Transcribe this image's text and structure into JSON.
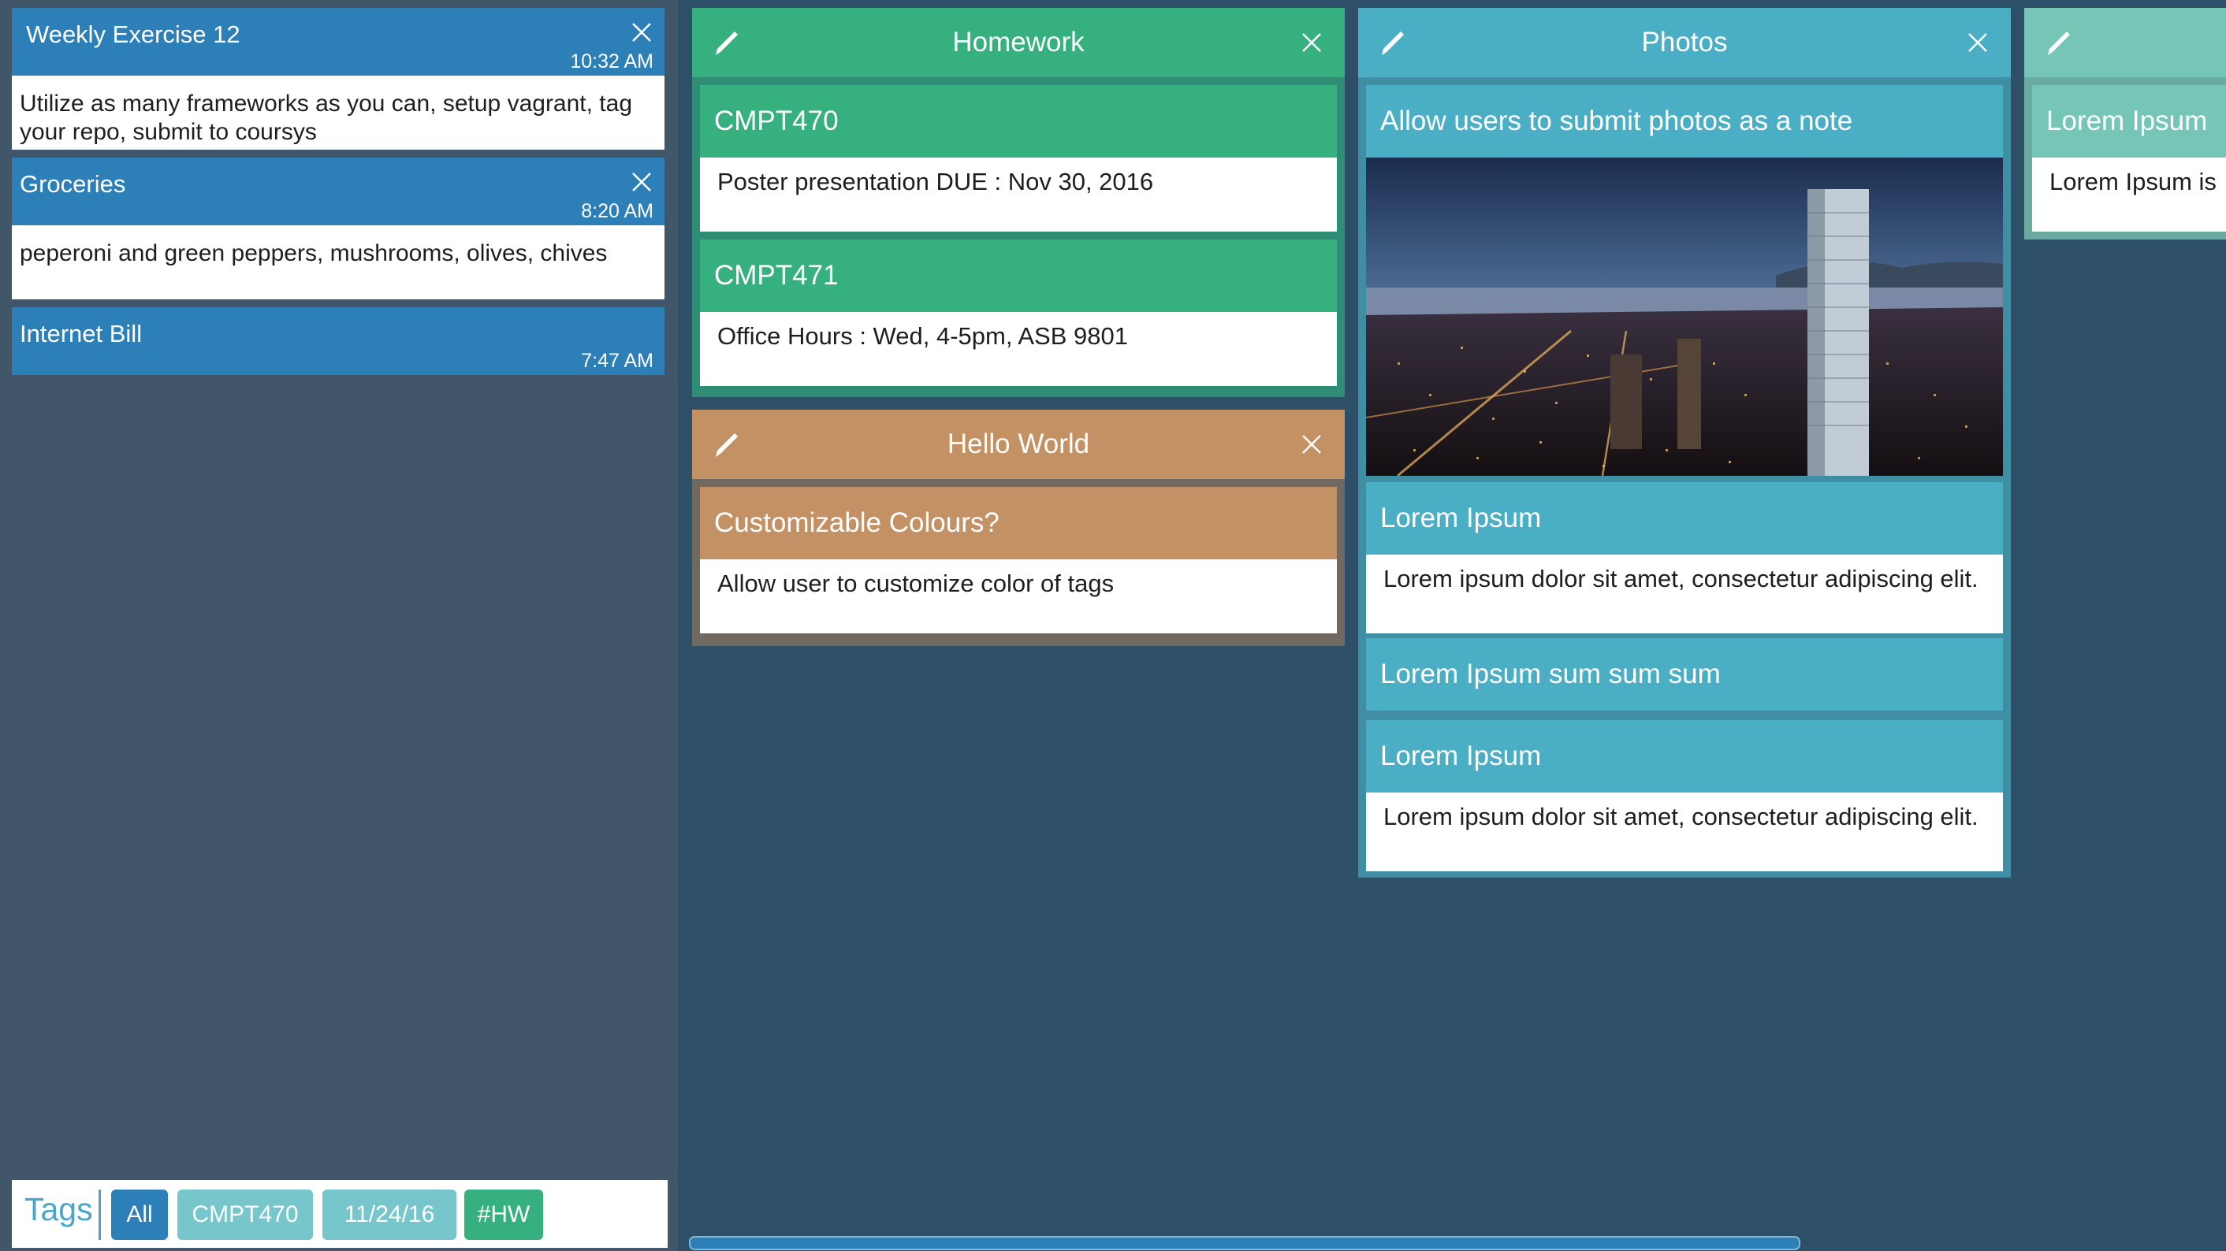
{
  "notes": [
    {
      "title": "Weekly Exercise 12",
      "time": "10:32 AM",
      "body": "Utilize as many frameworks as you can, setup vagrant, tag your repo, submit to coursys"
    },
    {
      "title": "Groceries",
      "time": "8:20 AM",
      "body": "peperoni and green peppers, mushrooms, olives, chives"
    },
    {
      "title": "Internet Bill",
      "time": "7:47 AM"
    }
  ],
  "tags": {
    "label": "Tags",
    "items": [
      {
        "label": "All",
        "color": "#2d7fb8"
      },
      {
        "label": "CMPT470",
        "color": "#76c6cc"
      },
      {
        "label": "11/24/16",
        "color": "#76c6cc"
      },
      {
        "label": "#HW",
        "color": "#36b07f"
      }
    ]
  },
  "boards": {
    "homework": {
      "title": "Homework",
      "color": "#36b07f",
      "frame": "#2f8c75",
      "cards": [
        {
          "title": "CMPT470",
          "body": "Poster presentation DUE : Nov 30, 2016"
        },
        {
          "title": "CMPT471",
          "body": "Office Hours : Wed, 4-5pm, ASB 9801"
        }
      ]
    },
    "hello": {
      "title": "Hello World",
      "color": "#c39163",
      "frame": "#6f6962",
      "cards": [
        {
          "title": "Customizable Colours?",
          "body": "Allow user to customize color of tags"
        }
      ]
    },
    "photos": {
      "title": "Photos",
      "color": "#4aafc4",
      "frame": "#3f8ea4",
      "cards": [
        {
          "title": "Allow users to submit photos as a note"
        },
        {
          "title": "Lorem Ipsum",
          "body": "Lorem ipsum dolor sit amet, consectetur adipiscing elit."
        },
        {
          "title": "Lorem Ipsum sum sum sum"
        },
        {
          "title": "Lorem Ipsum",
          "body": "Lorem ipsum dolor sit amet, consectetur adipiscing elit."
        }
      ]
    },
    "partial": {
      "color": "#76c6b8",
      "frame": "#6aab9f",
      "card": {
        "title": "Lorem Ipsum",
        "body": "Lorem Ipsum is"
      }
    }
  }
}
